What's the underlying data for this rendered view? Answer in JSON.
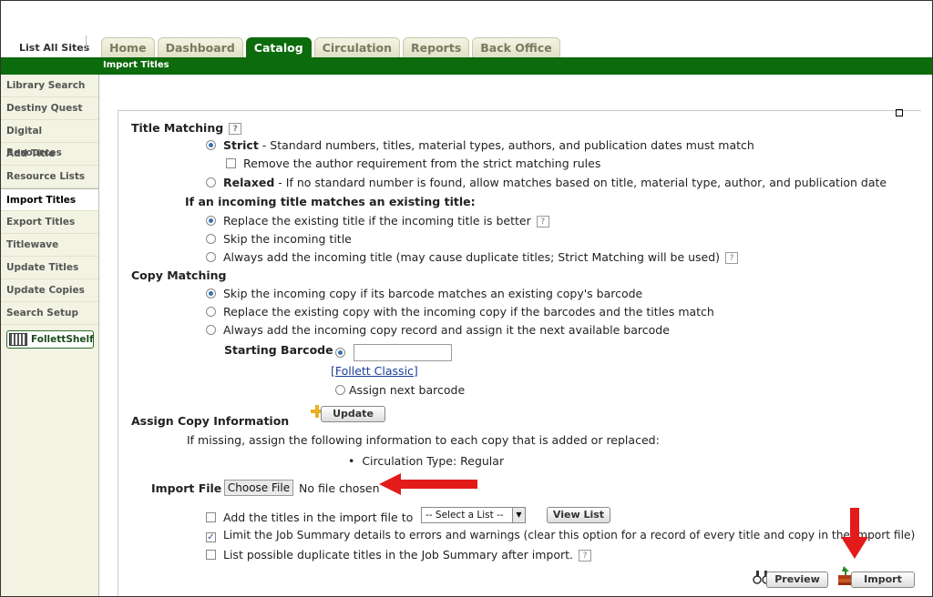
{
  "nav": {
    "site_link": "List All Sites",
    "tabs": [
      "Home",
      "Dashboard",
      "Catalog",
      "Circulation",
      "Reports",
      "Back Office"
    ],
    "active_tab": "Catalog",
    "subtab": "Import Titles"
  },
  "sidebar": {
    "items": [
      "Library Search",
      "Destiny Quest",
      "Digital Resources",
      "Add Title",
      "Resource Lists",
      "Import Titles",
      "Export Titles",
      "Titlewave",
      "Update Titles",
      "Update Copies",
      "Search Setup"
    ],
    "active": "Import Titles",
    "follettshelf": "FollettShelf"
  },
  "title_matching": {
    "header": "Title Matching",
    "strict_label": "Strict",
    "strict_desc": " - Standard numbers, titles, material types, authors, and publication dates must match",
    "remove_author": "Remove the author requirement from the strict matching rules",
    "relaxed_label": "Relaxed",
    "relaxed_desc": " - If no standard number is found, allow matches based on title, material type, author, and publication date"
  },
  "existing_title": {
    "header": "If an incoming title matches an existing title:",
    "opt1": "Replace the existing title if the incoming title is better",
    "opt2": "Skip the incoming title",
    "opt3": "Always add the incoming title (may cause duplicate titles; Strict Matching will be used)"
  },
  "copy_matching": {
    "header": "Copy Matching",
    "opt1": "Skip the incoming copy if its barcode matches an existing copy's barcode",
    "opt2": "Replace the existing copy with the incoming copy if the barcodes and the titles match",
    "opt3": "Always add the incoming copy record and assign it the next available barcode",
    "starting_barcode": "Starting Barcode",
    "barcode_value": "",
    "follett_classic": "[Follett Classic]",
    "assign_next": "Assign next barcode"
  },
  "assign_copy": {
    "header": "Assign Copy Information",
    "update_button": "Update",
    "missing_text": "If missing, assign the following information to each copy that is added or replaced:",
    "circ_type": "Circulation Type: Regular"
  },
  "import_file": {
    "label": "Import File",
    "choose_button": "Choose File",
    "status": "No file chosen"
  },
  "options": {
    "add_titles": "Add the titles in the import file to",
    "select_placeholder": "-- Select a List --",
    "view_list": "View List",
    "limit_summary": "Limit the Job Summary details to errors and warnings (clear this option for a record of every title and copy in the import file)",
    "list_duplicates": "List possible duplicate titles in the Job Summary after import."
  },
  "actions": {
    "preview": "Preview",
    "import": "Import"
  },
  "help_glyph": "?",
  "colors": {
    "accent": "#0c6b0c",
    "annotation_arrow": "#e31b1b"
  }
}
